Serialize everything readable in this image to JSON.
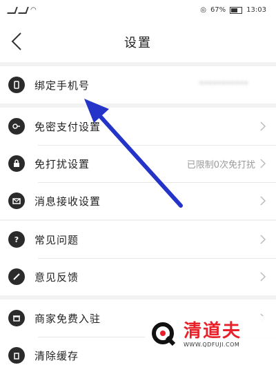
{
  "status_bar": {
    "battery_percent": "67%",
    "time": "13:03"
  },
  "header": {
    "title": "设置"
  },
  "sections": [
    {
      "items": [
        {
          "label": "绑定手机号",
          "value": "***********",
          "icon": "phone-icon",
          "chevron": false
        }
      ]
    },
    {
      "items": [
        {
          "label": "免密支付设置",
          "value": "",
          "icon": "key-icon",
          "chevron": true
        },
        {
          "label": "免打扰设置",
          "value": "已限制0次免打扰",
          "icon": "lock-icon",
          "chevron": true
        },
        {
          "label": "消息接收设置",
          "value": "",
          "icon": "mail-icon",
          "chevron": true
        }
      ]
    },
    {
      "items": [
        {
          "label": "常见问题",
          "value": "",
          "icon": "question-icon",
          "chevron": true
        },
        {
          "label": "意见反馈",
          "value": "",
          "icon": "edit-icon",
          "chevron": true
        }
      ]
    },
    {
      "items": [
        {
          "label": "商家免费入驻",
          "value": "",
          "icon": "store-icon",
          "chevron": true
        },
        {
          "label": "清除缓存",
          "value": "",
          "icon": "trash-icon",
          "chevron": true
        }
      ]
    }
  ],
  "watermark": {
    "brand": "清道夫",
    "url": "WWW.QDFUJI.COM"
  },
  "colors": {
    "annotation_arrow": "#2433c8",
    "watermark_red": "#e8202a",
    "page_bg": "#f2f2f2"
  }
}
